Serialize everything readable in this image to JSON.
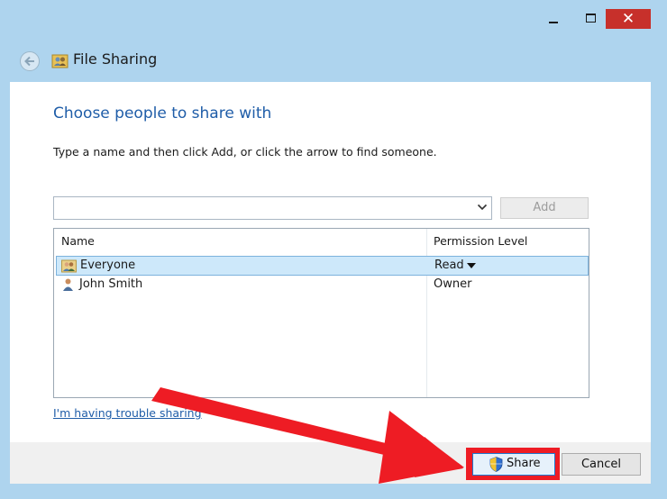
{
  "window": {
    "title": "File Sharing",
    "close_glyph": "✕"
  },
  "dialog": {
    "heading": "Choose people to share with",
    "instruction": "Type a name and then click Add, or click the arrow to find someone.",
    "add_button": "Add",
    "name_input": {
      "value": "",
      "placeholder": ""
    }
  },
  "list": {
    "columns": [
      "Name",
      "Permission Level"
    ],
    "rows": [
      {
        "name": "Everyone",
        "permission": "Read",
        "icon": "users-group-icon",
        "selected": true
      },
      {
        "name": "John Smith",
        "permission": "Owner",
        "icon": "user-icon",
        "selected": false
      }
    ]
  },
  "trouble_link": "I'm having trouble sharing",
  "footer": {
    "share_button": "Share",
    "cancel_button": "Cancel"
  },
  "colors": {
    "heading_blue": "#1f5da8",
    "annotation_red": "#ee1c24",
    "close_red": "#c7302b",
    "selection_blue": "#cde8fa"
  }
}
